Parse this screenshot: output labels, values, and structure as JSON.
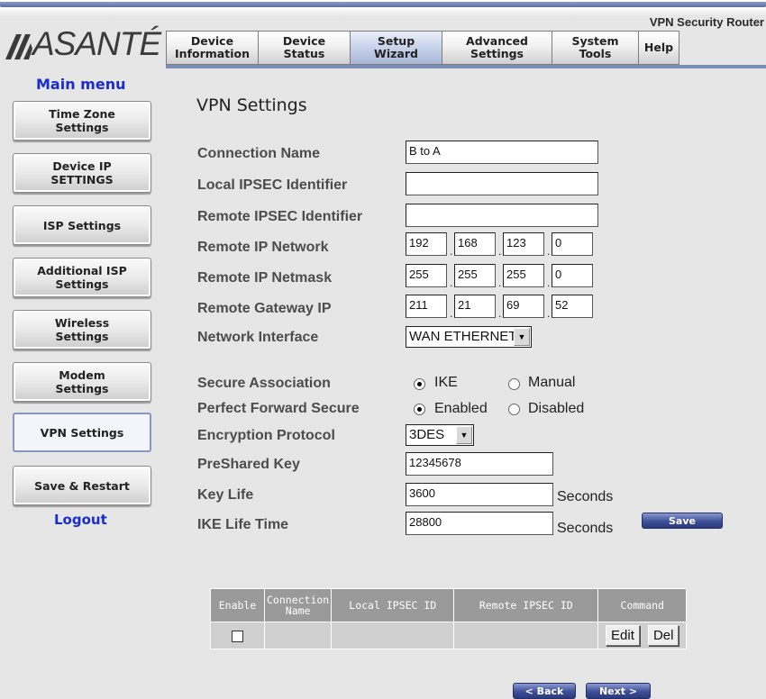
{
  "header": {
    "product_name": "VPN Security Router",
    "logo_text": "ASANTÉ"
  },
  "tabs": [
    {
      "label": "Device\nInformation"
    },
    {
      "label": "Device\nStatus"
    },
    {
      "label": "Setup\nWizard"
    },
    {
      "label": "Advanced\nSettings"
    },
    {
      "label": "System\nTools"
    },
    {
      "label": "Help"
    }
  ],
  "sidebar": {
    "title": "Main menu",
    "items": [
      {
        "label": "Time Zone\nSettings"
      },
      {
        "label": "Device IP\nSETTINGS"
      },
      {
        "label": "ISP Settings"
      },
      {
        "label": "Additional ISP\nSettings"
      },
      {
        "label": "Wireless\nSettings"
      },
      {
        "label": "Modem\nSettings"
      },
      {
        "label": "VPN Settings"
      },
      {
        "label": "Save & Restart"
      }
    ],
    "logout": "Logout"
  },
  "form": {
    "title": "VPN Settings",
    "labels": {
      "connection_name": "Connection Name",
      "local_ipsec": "Local IPSEC Identifier",
      "remote_ipsec": "Remote IPSEC Identifier",
      "remote_network": "Remote IP Network",
      "remote_netmask": "Remote IP Netmask",
      "remote_gateway": "Remote Gateway IP",
      "network_interface": "Network Interface",
      "secure_association": "Secure Association",
      "pfs": "Perfect Forward Secure",
      "encryption": "Encryption Protocol",
      "psk": "PreShared Key",
      "key_life": "Key Life",
      "ike_life": "IKE Life Time"
    },
    "values": {
      "connection_name": "B to A",
      "local_ipsec": "",
      "remote_ipsec": "",
      "remote_network": [
        "192",
        "168",
        "123",
        "0"
      ],
      "remote_netmask": [
        "255",
        "255",
        "255",
        "0"
      ],
      "remote_gateway": [
        "211",
        "21",
        "69",
        "52"
      ],
      "network_interface": "WAN ETHERNET",
      "encryption": "3DES",
      "psk": "12345678",
      "key_life": "3600",
      "ike_life": "28800"
    },
    "secure_association": {
      "option1": "IKE",
      "option2": "Manual",
      "selected": "IKE"
    },
    "pfs": {
      "option1": "Enabled",
      "option2": "Disabled",
      "selected": "Enabled"
    },
    "seconds_unit": "Seconds",
    "save_label": "Save"
  },
  "table": {
    "headers": [
      "Enable",
      "Connection\nName",
      "Local IPSEC ID",
      "Remote IPSEC ID",
      "Command"
    ],
    "row": {
      "edit": "Edit",
      "del": "Del"
    }
  },
  "nav": {
    "back": "< Back",
    "next": "Next >"
  }
}
